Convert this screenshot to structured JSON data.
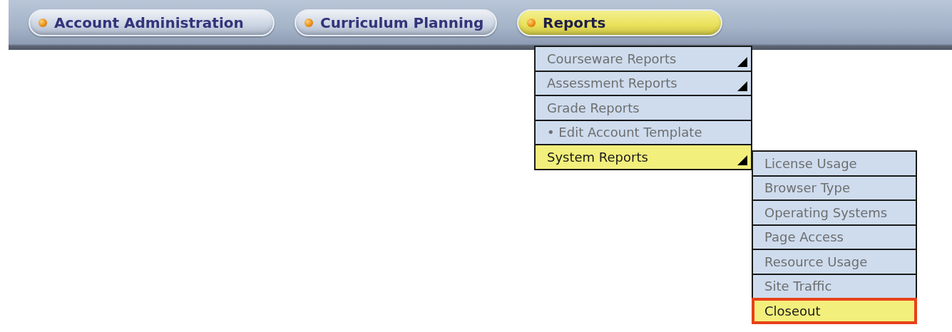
{
  "nav_tabs": [
    {
      "label": "Account Administration",
      "selected": false
    },
    {
      "label": "Curriculum Planning",
      "selected": false
    },
    {
      "label": "Reports",
      "selected": true
    }
  ],
  "menu": {
    "items": [
      {
        "label": "Courseware Reports",
        "selected": false,
        "has_submenu": true
      },
      {
        "label": "Assessment Reports",
        "selected": false,
        "has_submenu": true
      },
      {
        "label": "Grade Reports",
        "selected": false,
        "has_submenu": false
      },
      {
        "label": "• Edit Account Template",
        "selected": false,
        "has_submenu": false
      },
      {
        "label": "System Reports",
        "selected": true,
        "has_submenu": true
      }
    ]
  },
  "submenu": {
    "items": [
      {
        "label": "License Usage",
        "selected": false,
        "highlighted": false
      },
      {
        "label": "Browser Type",
        "selected": false,
        "highlighted": false
      },
      {
        "label": "Operating Systems",
        "selected": false,
        "highlighted": false
      },
      {
        "label": "Page Access",
        "selected": false,
        "highlighted": false
      },
      {
        "label": "Resource Usage",
        "selected": false,
        "highlighted": false
      },
      {
        "label": "Site Traffic",
        "selected": false,
        "highlighted": false
      },
      {
        "label": "Closeout",
        "selected": true,
        "highlighted": true
      }
    ]
  }
}
